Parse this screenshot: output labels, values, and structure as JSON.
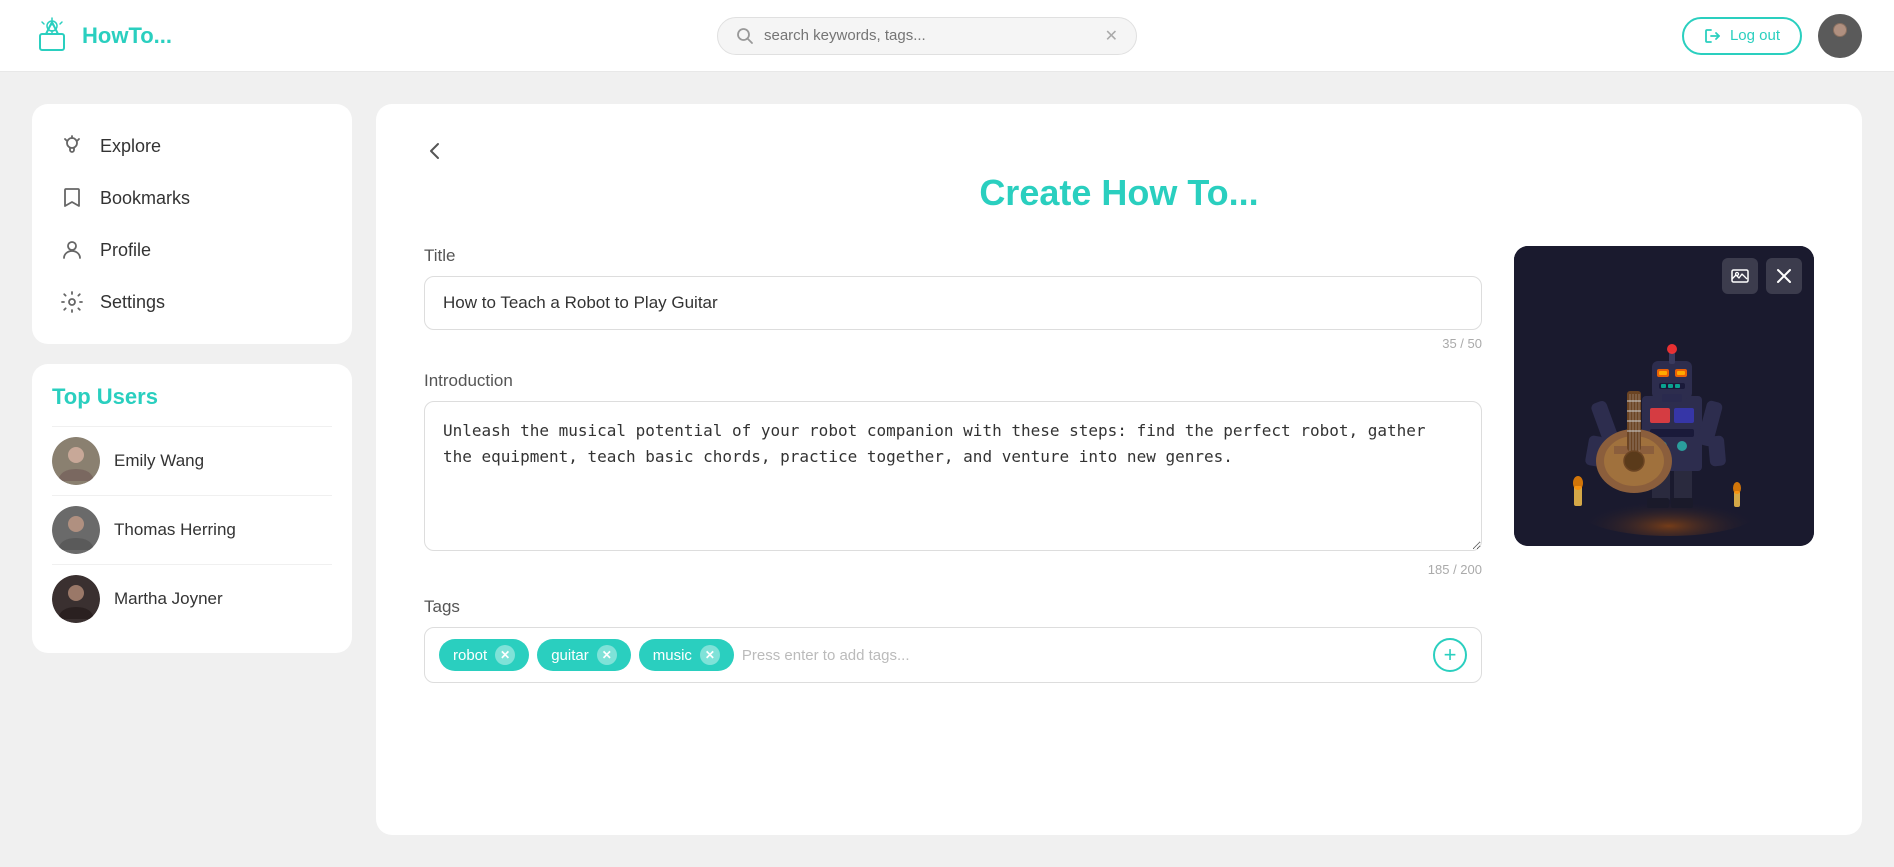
{
  "header": {
    "logo_text": "HowTo...",
    "search_placeholder": "search keywords, tags...",
    "logout_label": "Log out"
  },
  "sidebar": {
    "nav_items": [
      {
        "id": "explore",
        "label": "Explore",
        "icon": "bulb-icon"
      },
      {
        "id": "bookmarks",
        "label": "Bookmarks",
        "icon": "bookmark-icon"
      },
      {
        "id": "profile",
        "label": "Profile",
        "icon": "profile-icon"
      },
      {
        "id": "settings",
        "label": "Settings",
        "icon": "settings-icon"
      }
    ],
    "top_users_title": "Top Users",
    "top_users": [
      {
        "name": "Emily Wang",
        "id": "emily-wang"
      },
      {
        "name": "Thomas Herring",
        "id": "thomas-herring"
      },
      {
        "name": "Martha Joyner",
        "id": "martha-joyner"
      }
    ]
  },
  "form": {
    "page_title": "Create How To...",
    "title_label": "Title",
    "title_value": "How to Teach a Robot to Play Guitar",
    "title_char_count": "35 / 50",
    "intro_label": "Introduction",
    "intro_value": "Unleash the musical potential of your robot companion with these steps: find the perfect robot, gather the equipment, teach basic chords, practice together, and venture into new genres.",
    "intro_char_count": "185 / 200",
    "tags_label": "Tags",
    "tags": [
      {
        "label": "robot",
        "id": "tag-robot"
      },
      {
        "label": "guitar",
        "id": "tag-guitar"
      },
      {
        "label": "music",
        "id": "tag-music"
      }
    ],
    "tags_placeholder": "Press enter to add tags...",
    "tags_add_label": "+"
  },
  "colors": {
    "accent": "#2acfbf",
    "accent_dark": "#1ab0a0"
  }
}
